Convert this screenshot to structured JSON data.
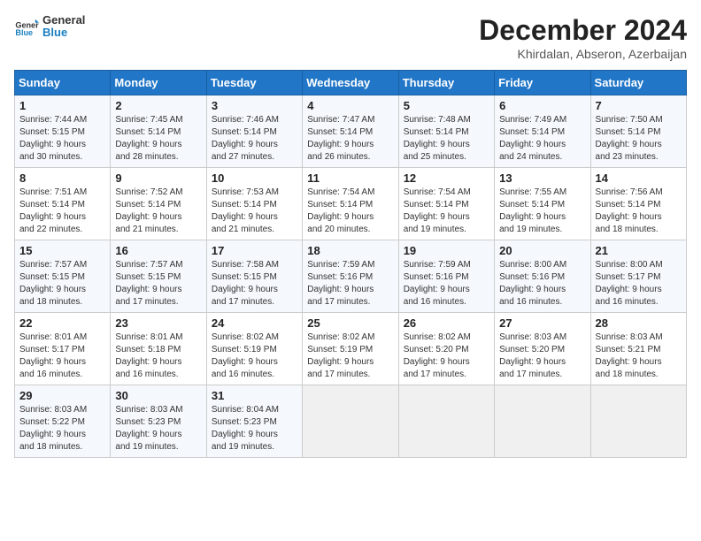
{
  "header": {
    "logo_line1": "General",
    "logo_line2": "Blue",
    "month": "December 2024",
    "location": "Khirdalan, Abseron, Azerbaijan"
  },
  "days_of_week": [
    "Sunday",
    "Monday",
    "Tuesday",
    "Wednesday",
    "Thursday",
    "Friday",
    "Saturday"
  ],
  "weeks": [
    [
      {
        "day": "1",
        "info": "Sunrise: 7:44 AM\nSunset: 5:15 PM\nDaylight: 9 hours\nand 30 minutes."
      },
      {
        "day": "2",
        "info": "Sunrise: 7:45 AM\nSunset: 5:14 PM\nDaylight: 9 hours\nand 28 minutes."
      },
      {
        "day": "3",
        "info": "Sunrise: 7:46 AM\nSunset: 5:14 PM\nDaylight: 9 hours\nand 27 minutes."
      },
      {
        "day": "4",
        "info": "Sunrise: 7:47 AM\nSunset: 5:14 PM\nDaylight: 9 hours\nand 26 minutes."
      },
      {
        "day": "5",
        "info": "Sunrise: 7:48 AM\nSunset: 5:14 PM\nDaylight: 9 hours\nand 25 minutes."
      },
      {
        "day": "6",
        "info": "Sunrise: 7:49 AM\nSunset: 5:14 PM\nDaylight: 9 hours\nand 24 minutes."
      },
      {
        "day": "7",
        "info": "Sunrise: 7:50 AM\nSunset: 5:14 PM\nDaylight: 9 hours\nand 23 minutes."
      }
    ],
    [
      {
        "day": "8",
        "info": "Sunrise: 7:51 AM\nSunset: 5:14 PM\nDaylight: 9 hours\nand 22 minutes."
      },
      {
        "day": "9",
        "info": "Sunrise: 7:52 AM\nSunset: 5:14 PM\nDaylight: 9 hours\nand 21 minutes."
      },
      {
        "day": "10",
        "info": "Sunrise: 7:53 AM\nSunset: 5:14 PM\nDaylight: 9 hours\nand 21 minutes."
      },
      {
        "day": "11",
        "info": "Sunrise: 7:54 AM\nSunset: 5:14 PM\nDaylight: 9 hours\nand 20 minutes."
      },
      {
        "day": "12",
        "info": "Sunrise: 7:54 AM\nSunset: 5:14 PM\nDaylight: 9 hours\nand 19 minutes."
      },
      {
        "day": "13",
        "info": "Sunrise: 7:55 AM\nSunset: 5:14 PM\nDaylight: 9 hours\nand 19 minutes."
      },
      {
        "day": "14",
        "info": "Sunrise: 7:56 AM\nSunset: 5:14 PM\nDaylight: 9 hours\nand 18 minutes."
      }
    ],
    [
      {
        "day": "15",
        "info": "Sunrise: 7:57 AM\nSunset: 5:15 PM\nDaylight: 9 hours\nand 18 minutes."
      },
      {
        "day": "16",
        "info": "Sunrise: 7:57 AM\nSunset: 5:15 PM\nDaylight: 9 hours\nand 17 minutes."
      },
      {
        "day": "17",
        "info": "Sunrise: 7:58 AM\nSunset: 5:15 PM\nDaylight: 9 hours\nand 17 minutes."
      },
      {
        "day": "18",
        "info": "Sunrise: 7:59 AM\nSunset: 5:16 PM\nDaylight: 9 hours\nand 17 minutes."
      },
      {
        "day": "19",
        "info": "Sunrise: 7:59 AM\nSunset: 5:16 PM\nDaylight: 9 hours\nand 16 minutes."
      },
      {
        "day": "20",
        "info": "Sunrise: 8:00 AM\nSunset: 5:16 PM\nDaylight: 9 hours\nand 16 minutes."
      },
      {
        "day": "21",
        "info": "Sunrise: 8:00 AM\nSunset: 5:17 PM\nDaylight: 9 hours\nand 16 minutes."
      }
    ],
    [
      {
        "day": "22",
        "info": "Sunrise: 8:01 AM\nSunset: 5:17 PM\nDaylight: 9 hours\nand 16 minutes."
      },
      {
        "day": "23",
        "info": "Sunrise: 8:01 AM\nSunset: 5:18 PM\nDaylight: 9 hours\nand 16 minutes."
      },
      {
        "day": "24",
        "info": "Sunrise: 8:02 AM\nSunset: 5:19 PM\nDaylight: 9 hours\nand 16 minutes."
      },
      {
        "day": "25",
        "info": "Sunrise: 8:02 AM\nSunset: 5:19 PM\nDaylight: 9 hours\nand 17 minutes."
      },
      {
        "day": "26",
        "info": "Sunrise: 8:02 AM\nSunset: 5:20 PM\nDaylight: 9 hours\nand 17 minutes."
      },
      {
        "day": "27",
        "info": "Sunrise: 8:03 AM\nSunset: 5:20 PM\nDaylight: 9 hours\nand 17 minutes."
      },
      {
        "day": "28",
        "info": "Sunrise: 8:03 AM\nSunset: 5:21 PM\nDaylight: 9 hours\nand 18 minutes."
      }
    ],
    [
      {
        "day": "29",
        "info": "Sunrise: 8:03 AM\nSunset: 5:22 PM\nDaylight: 9 hours\nand 18 minutes."
      },
      {
        "day": "30",
        "info": "Sunrise: 8:03 AM\nSunset: 5:23 PM\nDaylight: 9 hours\nand 19 minutes."
      },
      {
        "day": "31",
        "info": "Sunrise: 8:04 AM\nSunset: 5:23 PM\nDaylight: 9 hours\nand 19 minutes."
      },
      {
        "day": "",
        "info": ""
      },
      {
        "day": "",
        "info": ""
      },
      {
        "day": "",
        "info": ""
      },
      {
        "day": "",
        "info": ""
      }
    ]
  ]
}
